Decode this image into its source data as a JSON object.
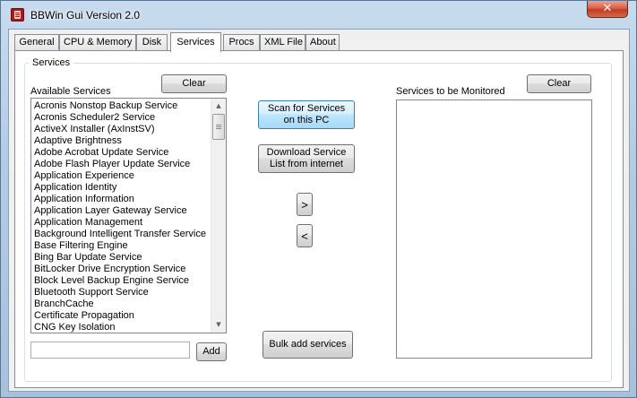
{
  "window": {
    "title": "BBWin Gui Version 2.0",
    "close_label": "✕"
  },
  "tabs": [
    {
      "label": "General"
    },
    {
      "label": "CPU & Memory"
    },
    {
      "label": "Disk"
    },
    {
      "label": "Services",
      "active": true
    },
    {
      "label": "Procs"
    },
    {
      "label": "XML File"
    },
    {
      "label": "About"
    }
  ],
  "services": {
    "group_title": "Services",
    "available_label": "Available Services",
    "monitored_label": "Services to be Monitored",
    "clear_left_label": "Clear",
    "clear_right_label": "Clear",
    "scan_button": [
      "Scan for Services",
      "on this PC"
    ],
    "download_button": [
      "Download Service",
      "List from internet"
    ],
    "move_right_label": ">",
    "move_left_label": "<",
    "bulk_add_label": "Bulk add services",
    "add_label": "Add",
    "add_input_value": "",
    "available_services": [
      "Acronis Nonstop Backup Service",
      "Acronis Scheduler2 Service",
      "ActiveX Installer (AxInstSV)",
      "Adaptive Brightness",
      "Adobe Acrobat Update Service",
      "Adobe Flash Player Update Service",
      "Application Experience",
      "Application Identity",
      "Application Information",
      "Application Layer Gateway Service",
      "Application Management",
      "Background Intelligent Transfer Service",
      "Base Filtering Engine",
      "Bing Bar Update Service",
      "BitLocker Drive Encryption Service",
      "Block Level Backup Engine Service",
      "Bluetooth Support Service",
      "BranchCache",
      "Certificate Propagation",
      "CNG Key Isolation"
    ],
    "monitored_services": []
  },
  "icons": {
    "scroll_up": "▲",
    "scroll_down": "▼"
  }
}
